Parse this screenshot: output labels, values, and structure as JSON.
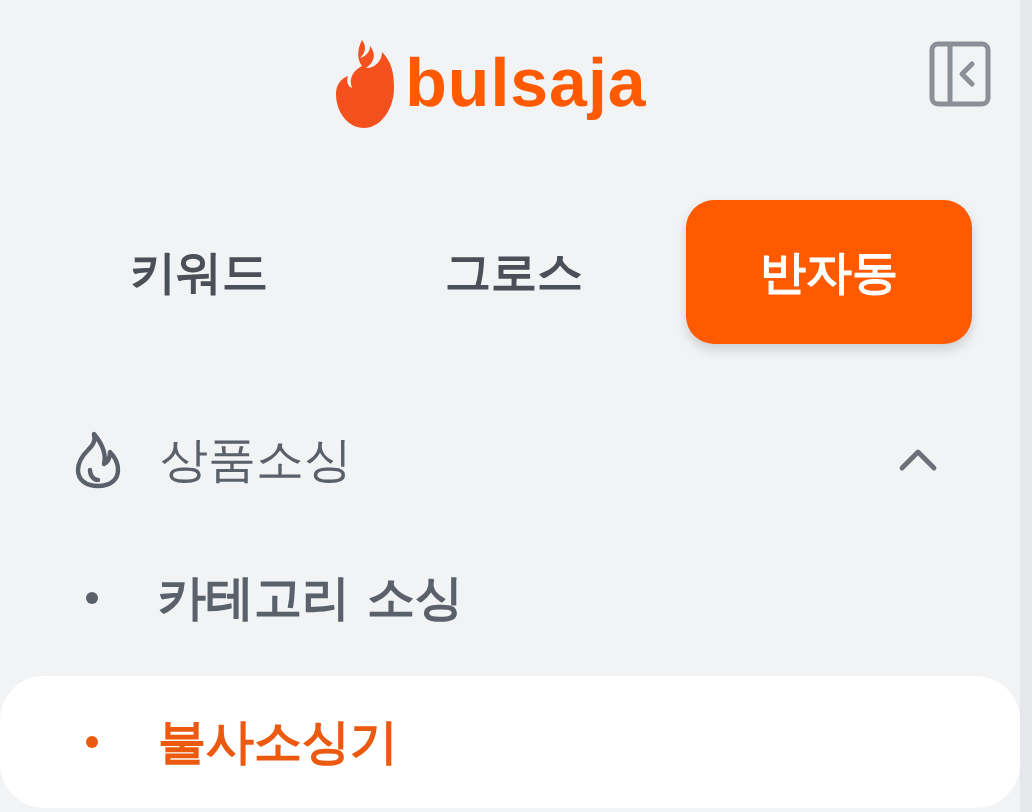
{
  "logo": {
    "text": "bulsaja"
  },
  "tabs": [
    {
      "label": "키워드",
      "selected": false
    },
    {
      "label": "그로스",
      "selected": false
    },
    {
      "label": "반자동",
      "selected": true
    }
  ],
  "menu": {
    "label": "상품소싱",
    "expanded": true,
    "children": [
      {
        "label": "카테고리 소싱",
        "selected": false
      },
      {
        "label": "불사소싱기",
        "selected": true
      }
    ]
  }
}
